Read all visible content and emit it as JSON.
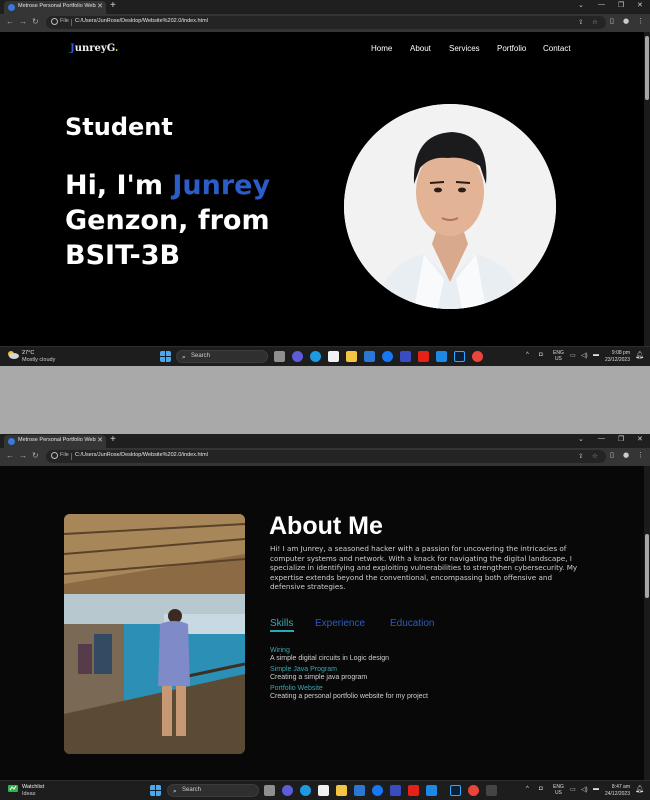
{
  "colors": {
    "accent_blue": "#2c5cc7",
    "skill_teal": "#3aa7b2",
    "page_bg": "#000000",
    "browser_chrome": "#353535"
  },
  "browser": {
    "tab_title": "Metrose Personal Portfolio Website",
    "omnibox_label": "File",
    "url": "C:/Users/JunRose/Desktop/Website%202.0/index.html"
  },
  "screens": [
    {
      "logo": {
        "first": "J",
        "rest": "unrey",
        "g": "G",
        "dot": "."
      },
      "nav": [
        "Home",
        "About",
        "Services",
        "Portfolio",
        "Contact"
      ],
      "hero": {
        "role": "Student",
        "line1_prefix": "Hi, I'm ",
        "line1_highlight": "Junrey",
        "line2": "Genzon, from",
        "line3": "BSIT-3B"
      },
      "taskbar": {
        "weather_temp": "27°C",
        "weather_desc": "Mostly cloudy",
        "search": "Search",
        "lang_top": "ENG",
        "lang_bottom": "US",
        "time": "9:08 pm",
        "date": "23/12/2023"
      }
    },
    {
      "about": {
        "title": "About Me",
        "text": "Hi! I am Junrey, a seasoned hacker with a passion for uncovering the intricacies of computer systems and network. With a knack for navigating the digital landscape, I specialize in identifying and exploiting vulnerabilities to strengthen cybersecurity. My expertise extends beyond the conventional, encompassing both offensive and defensive strategies.",
        "tabs": [
          "Skills",
          "Experience",
          "Education"
        ],
        "skills": [
          {
            "name": "Wiring",
            "desc": "A simple digital circuits in Logic design"
          },
          {
            "name": "Simple Java Program",
            "desc": "Creating a simple java program"
          },
          {
            "name": "Portfolio Website",
            "desc": "Creating a personal portfolio website for my project"
          }
        ]
      },
      "taskbar": {
        "weather_temp": "Watchlist",
        "weather_desc": "Ideas",
        "search": "Search",
        "lang_top": "ENG",
        "lang_bottom": "US",
        "time": "8:47 am",
        "date": "24/12/2023"
      }
    }
  ]
}
